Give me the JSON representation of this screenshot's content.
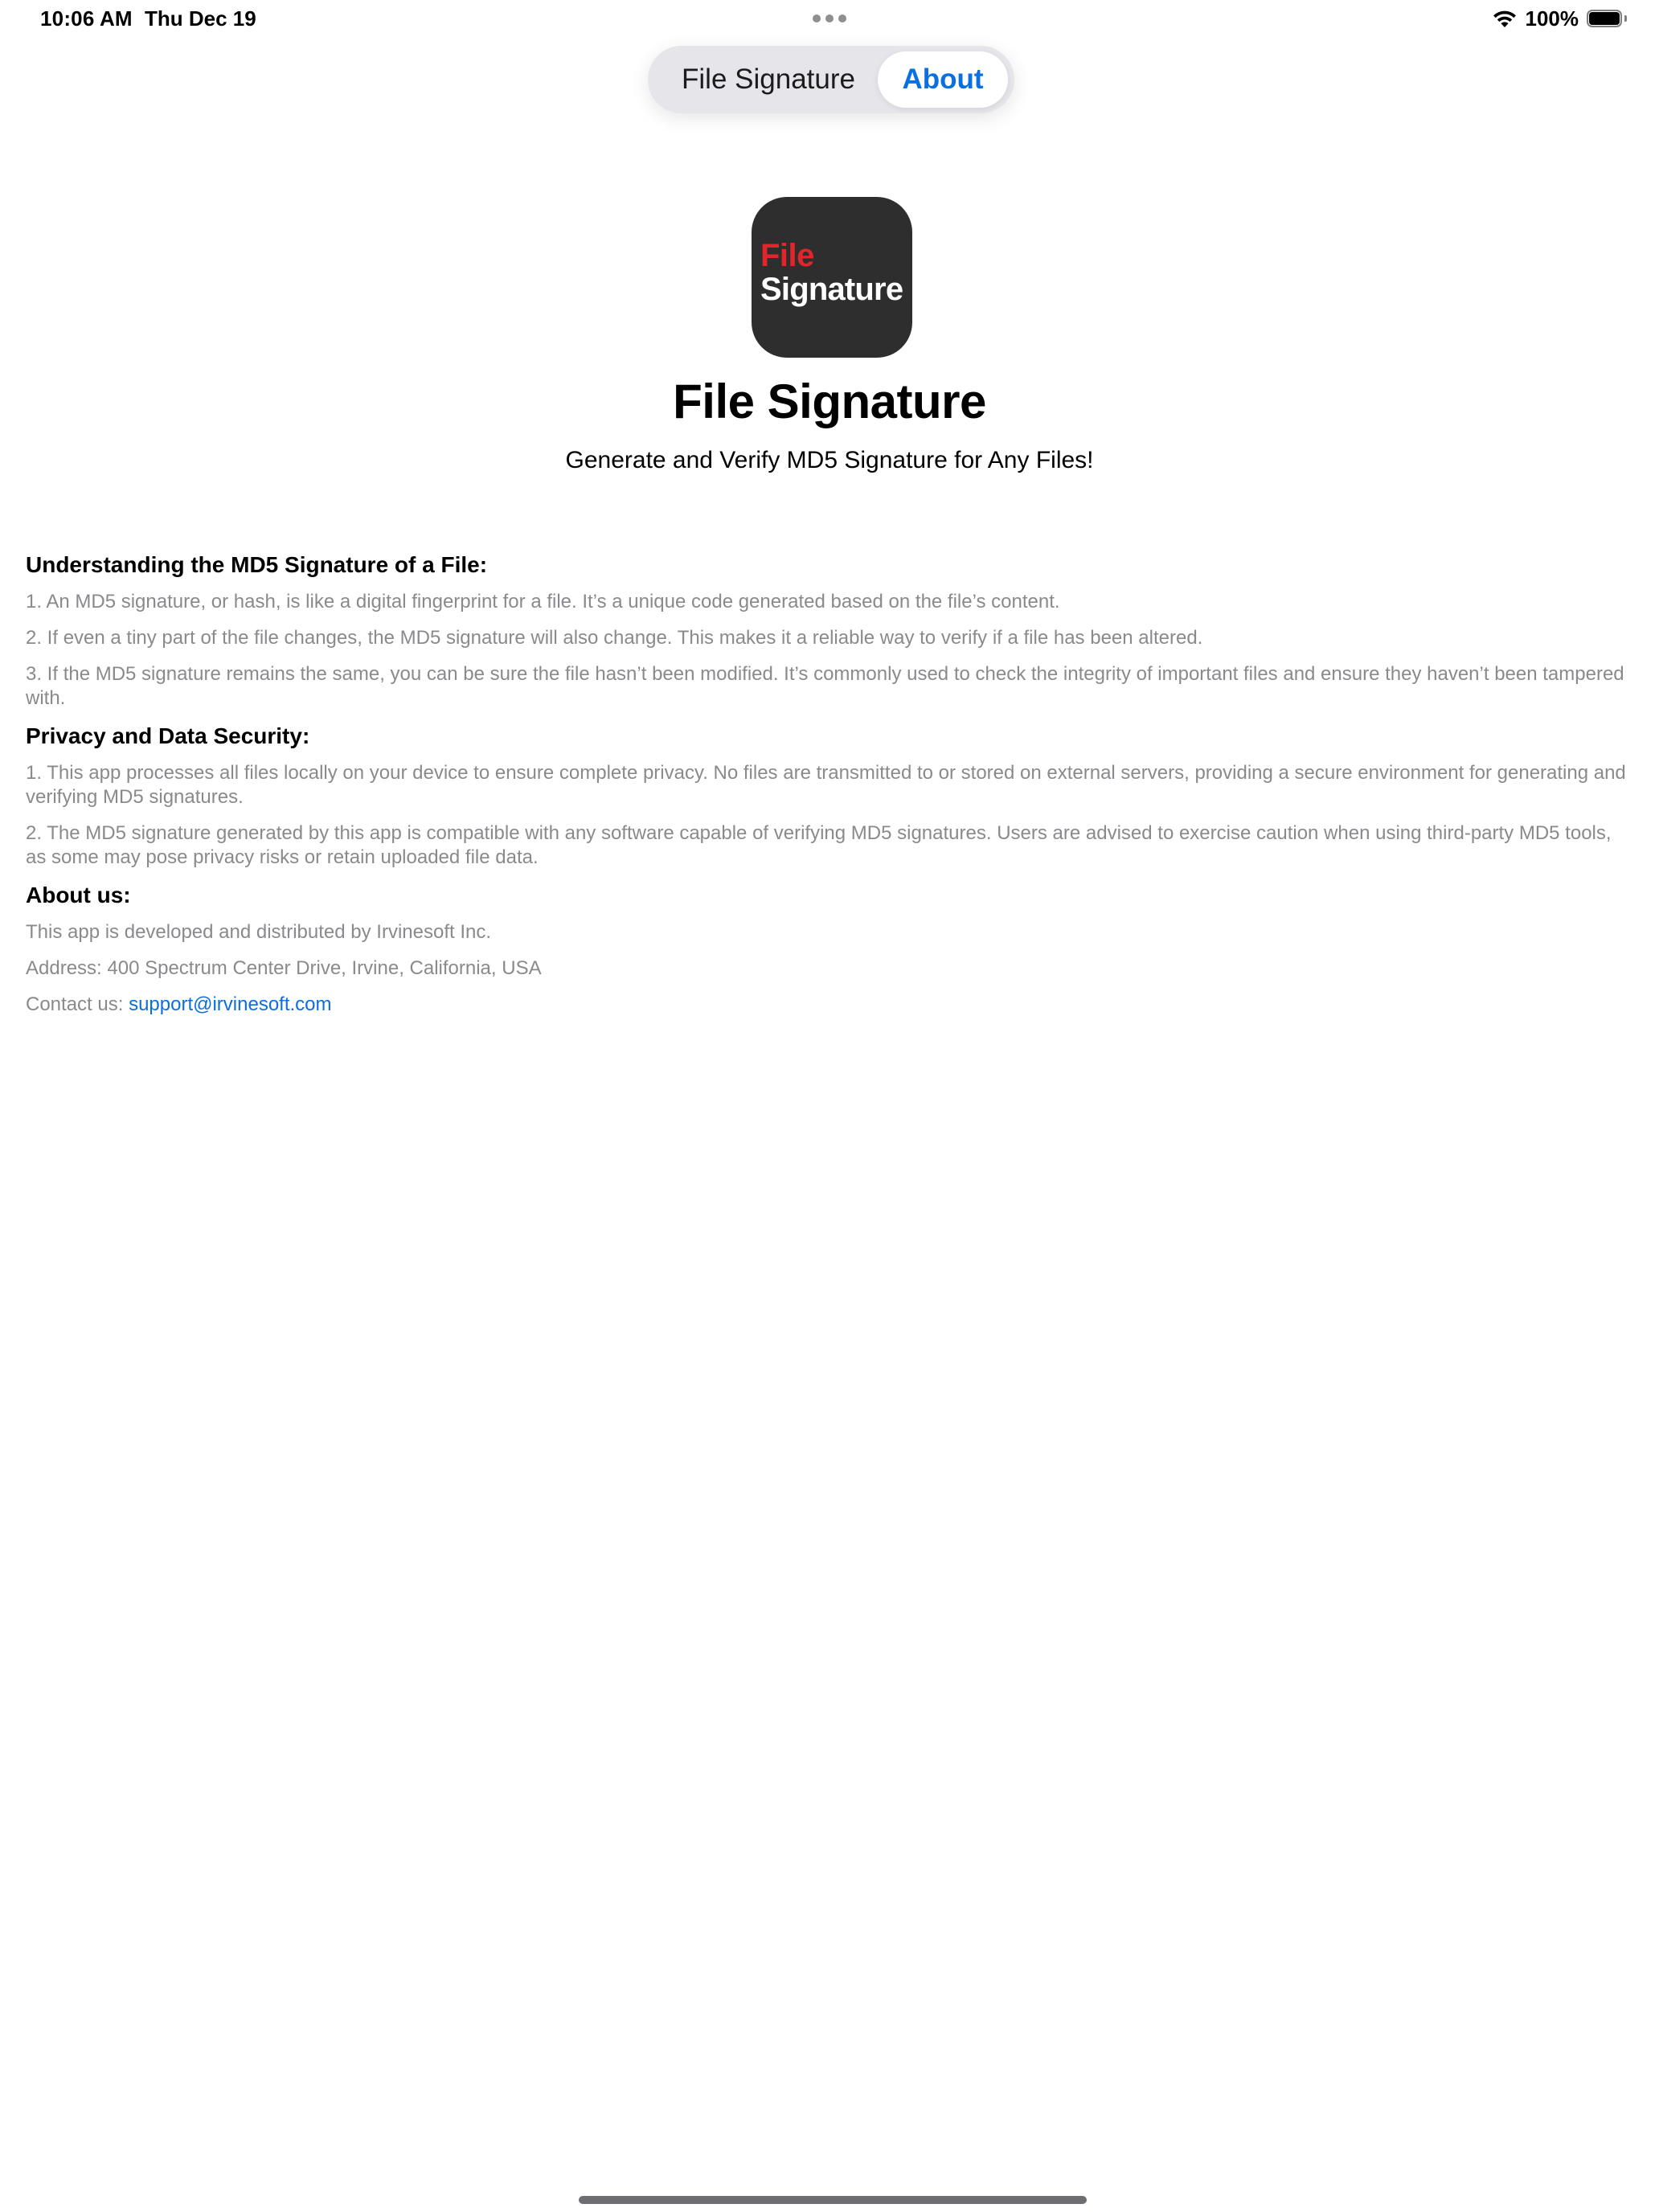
{
  "status_bar": {
    "time": "10:06 AM",
    "date": "Thu Dec 19",
    "battery": "100%"
  },
  "tabs": {
    "file_signature": "File Signature",
    "about": "About",
    "active_color": "#0a6fe0"
  },
  "app": {
    "icon_line1": "File",
    "icon_line2": "Signature",
    "title": "File Signature",
    "subtitle": "Generate and Verify MD5 Signature for Any Files!"
  },
  "sections": {
    "understanding": {
      "heading": "Understanding the MD5 Signature of a File:",
      "p1": "1. An MD5 signature, or hash, is like a digital fingerprint for a file. It’s a unique code generated based on the file’s content.",
      "p2": "2. If even a tiny part of the file changes, the MD5 signature will also change. This makes it a reliable way to verify if a file has been altered.",
      "p3": "3. If the MD5 signature remains the same, you can be sure the file hasn’t been modified. It’s commonly used to check the integrity of important files and ensure they haven’t been tampered with."
    },
    "privacy": {
      "heading": "Privacy and Data Security:",
      "p1": "1. This app processes all files locally on your device to ensure complete privacy. No files are transmitted to or stored on external servers, providing a secure environment for generating and verifying MD5 signatures.",
      "p2": "2. The MD5 signature generated by this app is compatible with any software capable of verifying MD5 signatures. Users are advised to exercise caution when using third-party MD5 tools, as some may pose privacy risks or retain uploaded file data."
    },
    "about": {
      "heading": "About us:",
      "developer": "This app is developed and distributed by Irvinesoft Inc.",
      "address": "Address: 400 Spectrum Center Drive, Irvine, California, USA",
      "contact_label": "Contact us: ",
      "contact_email": "support@irvinesoft.com"
    }
  }
}
